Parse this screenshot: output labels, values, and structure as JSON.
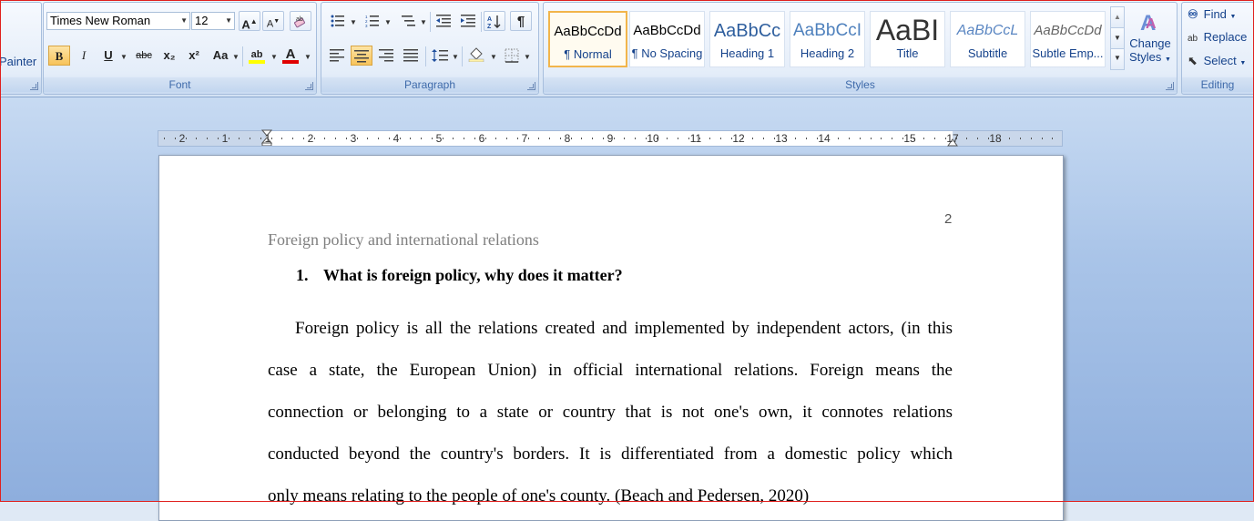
{
  "clipboard": {
    "format_painter_label": "Painter"
  },
  "font_group": {
    "label": "Font",
    "font_name": "Times New Roman",
    "font_size": "12",
    "grow_glyph": "A",
    "shrink_glyph": "A",
    "bold_glyph": "B",
    "italic_glyph": "I",
    "underline_glyph": "U",
    "strike_glyph": "abc",
    "subscript_glyph": "x₂",
    "superscript_glyph": "x²",
    "case_glyph": "Aa",
    "highlight_glyph": "ab",
    "font_color_glyph": "A",
    "highlight_color": "#ffff00",
    "font_color": "#e00000"
  },
  "paragraph_group": {
    "label": "Paragraph",
    "show_marks_glyph": "¶"
  },
  "styles_group": {
    "label": "Styles",
    "tiles": [
      {
        "sample": "AaBbCcDd",
        "name": "¶ Normal"
      },
      {
        "sample": "AaBbCcDd",
        "name": "¶ No Spacing"
      },
      {
        "sample": "AaBbCc",
        "name": "Heading 1"
      },
      {
        "sample": "AaBbCcI",
        "name": "Heading 2"
      },
      {
        "sample": "AaBI",
        "name": "Title"
      },
      {
        "sample": "AaBbCcL",
        "name": "Subtitle"
      },
      {
        "sample": "AaBbCcDd",
        "name": "Subtle Emp..."
      }
    ],
    "change_styles_line1": "Change",
    "change_styles_line2": "Styles"
  },
  "editing_group": {
    "label": "Editing",
    "find": "Find",
    "replace": "Replace",
    "select": "Select"
  },
  "ruler": {
    "numbers": [
      "2",
      "1",
      "1",
      "2",
      "3",
      "4",
      "5",
      "6",
      "7",
      "8",
      "9",
      "10",
      "11",
      "12",
      "13",
      "14",
      "15",
      "17",
      "18"
    ]
  },
  "document": {
    "page_number": "2",
    "header": "Foreign policy and international relations",
    "heading_number": "1.",
    "heading_text": "What is foreign policy, why does it matter?",
    "body_lines": [
      "Foreign policy is all the relations created and implemented by independent actors, (in this",
      "case a state, the European Union) in official international relations. Foreign means the",
      "connection or belonging to a state or country that is not one's own, it connotes relations",
      "conducted beyond the country's borders. It is differentiated from a domestic policy which",
      "only means relating to the people of one's county. (Beach and Pedersen, 2020)"
    ]
  }
}
